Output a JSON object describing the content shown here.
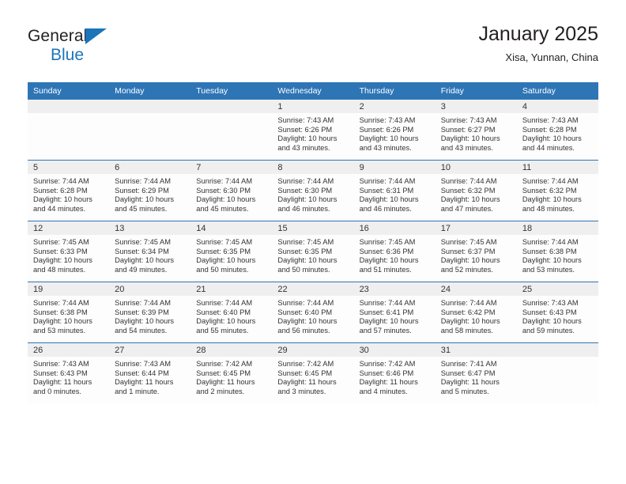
{
  "brand": {
    "name_dark": "General",
    "name_blue": "Blue",
    "triangle_color": "#1b75bb"
  },
  "header": {
    "title": "January 2025",
    "subtitle": "Xisa, Yunnan, China",
    "header_bg": "#2e75b6",
    "header_text_color": "#ffffff"
  },
  "weekday_headers": [
    "Sunday",
    "Monday",
    "Tuesday",
    "Wednesday",
    "Thursday",
    "Friday",
    "Saturday"
  ],
  "labels": {
    "sunrise_prefix": "Sunrise:",
    "sunset_prefix": "Sunset:",
    "daylight_prefix": "Daylight:"
  },
  "weeks": [
    [
      {
        "day": "",
        "empty": true
      },
      {
        "day": "",
        "empty": true
      },
      {
        "day": "",
        "empty": true
      },
      {
        "day": "1",
        "sunrise": "Sunrise: 7:43 AM",
        "sunset": "Sunset: 6:26 PM",
        "daylight": "Daylight: 10 hours and 43 minutes."
      },
      {
        "day": "2",
        "sunrise": "Sunrise: 7:43 AM",
        "sunset": "Sunset: 6:26 PM",
        "daylight": "Daylight: 10 hours and 43 minutes."
      },
      {
        "day": "3",
        "sunrise": "Sunrise: 7:43 AM",
        "sunset": "Sunset: 6:27 PM",
        "daylight": "Daylight: 10 hours and 43 minutes."
      },
      {
        "day": "4",
        "sunrise": "Sunrise: 7:43 AM",
        "sunset": "Sunset: 6:28 PM",
        "daylight": "Daylight: 10 hours and 44 minutes."
      }
    ],
    [
      {
        "day": "5",
        "sunrise": "Sunrise: 7:44 AM",
        "sunset": "Sunset: 6:28 PM",
        "daylight": "Daylight: 10 hours and 44 minutes."
      },
      {
        "day": "6",
        "sunrise": "Sunrise: 7:44 AM",
        "sunset": "Sunset: 6:29 PM",
        "daylight": "Daylight: 10 hours and 45 minutes."
      },
      {
        "day": "7",
        "sunrise": "Sunrise: 7:44 AM",
        "sunset": "Sunset: 6:30 PM",
        "daylight": "Daylight: 10 hours and 45 minutes."
      },
      {
        "day": "8",
        "sunrise": "Sunrise: 7:44 AM",
        "sunset": "Sunset: 6:30 PM",
        "daylight": "Daylight: 10 hours and 46 minutes."
      },
      {
        "day": "9",
        "sunrise": "Sunrise: 7:44 AM",
        "sunset": "Sunset: 6:31 PM",
        "daylight": "Daylight: 10 hours and 46 minutes."
      },
      {
        "day": "10",
        "sunrise": "Sunrise: 7:44 AM",
        "sunset": "Sunset: 6:32 PM",
        "daylight": "Daylight: 10 hours and 47 minutes."
      },
      {
        "day": "11",
        "sunrise": "Sunrise: 7:44 AM",
        "sunset": "Sunset: 6:32 PM",
        "daylight": "Daylight: 10 hours and 48 minutes."
      }
    ],
    [
      {
        "day": "12",
        "sunrise": "Sunrise: 7:45 AM",
        "sunset": "Sunset: 6:33 PM",
        "daylight": "Daylight: 10 hours and 48 minutes."
      },
      {
        "day": "13",
        "sunrise": "Sunrise: 7:45 AM",
        "sunset": "Sunset: 6:34 PM",
        "daylight": "Daylight: 10 hours and 49 minutes."
      },
      {
        "day": "14",
        "sunrise": "Sunrise: 7:45 AM",
        "sunset": "Sunset: 6:35 PM",
        "daylight": "Daylight: 10 hours and 50 minutes."
      },
      {
        "day": "15",
        "sunrise": "Sunrise: 7:45 AM",
        "sunset": "Sunset: 6:35 PM",
        "daylight": "Daylight: 10 hours and 50 minutes."
      },
      {
        "day": "16",
        "sunrise": "Sunrise: 7:45 AM",
        "sunset": "Sunset: 6:36 PM",
        "daylight": "Daylight: 10 hours and 51 minutes."
      },
      {
        "day": "17",
        "sunrise": "Sunrise: 7:45 AM",
        "sunset": "Sunset: 6:37 PM",
        "daylight": "Daylight: 10 hours and 52 minutes."
      },
      {
        "day": "18",
        "sunrise": "Sunrise: 7:44 AM",
        "sunset": "Sunset: 6:38 PM",
        "daylight": "Daylight: 10 hours and 53 minutes."
      }
    ],
    [
      {
        "day": "19",
        "sunrise": "Sunrise: 7:44 AM",
        "sunset": "Sunset: 6:38 PM",
        "daylight": "Daylight: 10 hours and 53 minutes."
      },
      {
        "day": "20",
        "sunrise": "Sunrise: 7:44 AM",
        "sunset": "Sunset: 6:39 PM",
        "daylight": "Daylight: 10 hours and 54 minutes."
      },
      {
        "day": "21",
        "sunrise": "Sunrise: 7:44 AM",
        "sunset": "Sunset: 6:40 PM",
        "daylight": "Daylight: 10 hours and 55 minutes."
      },
      {
        "day": "22",
        "sunrise": "Sunrise: 7:44 AM",
        "sunset": "Sunset: 6:40 PM",
        "daylight": "Daylight: 10 hours and 56 minutes."
      },
      {
        "day": "23",
        "sunrise": "Sunrise: 7:44 AM",
        "sunset": "Sunset: 6:41 PM",
        "daylight": "Daylight: 10 hours and 57 minutes."
      },
      {
        "day": "24",
        "sunrise": "Sunrise: 7:44 AM",
        "sunset": "Sunset: 6:42 PM",
        "daylight": "Daylight: 10 hours and 58 minutes."
      },
      {
        "day": "25",
        "sunrise": "Sunrise: 7:43 AM",
        "sunset": "Sunset: 6:43 PM",
        "daylight": "Daylight: 10 hours and 59 minutes."
      }
    ],
    [
      {
        "day": "26",
        "sunrise": "Sunrise: 7:43 AM",
        "sunset": "Sunset: 6:43 PM",
        "daylight": "Daylight: 11 hours and 0 minutes."
      },
      {
        "day": "27",
        "sunrise": "Sunrise: 7:43 AM",
        "sunset": "Sunset: 6:44 PM",
        "daylight": "Daylight: 11 hours and 1 minute."
      },
      {
        "day": "28",
        "sunrise": "Sunrise: 7:42 AM",
        "sunset": "Sunset: 6:45 PM",
        "daylight": "Daylight: 11 hours and 2 minutes."
      },
      {
        "day": "29",
        "sunrise": "Sunrise: 7:42 AM",
        "sunset": "Sunset: 6:45 PM",
        "daylight": "Daylight: 11 hours and 3 minutes."
      },
      {
        "day": "30",
        "sunrise": "Sunrise: 7:42 AM",
        "sunset": "Sunset: 6:46 PM",
        "daylight": "Daylight: 11 hours and 4 minutes."
      },
      {
        "day": "31",
        "sunrise": "Sunrise: 7:41 AM",
        "sunset": "Sunset: 6:47 PM",
        "daylight": "Daylight: 11 hours and 5 minutes."
      },
      {
        "day": "",
        "empty": true
      }
    ]
  ]
}
